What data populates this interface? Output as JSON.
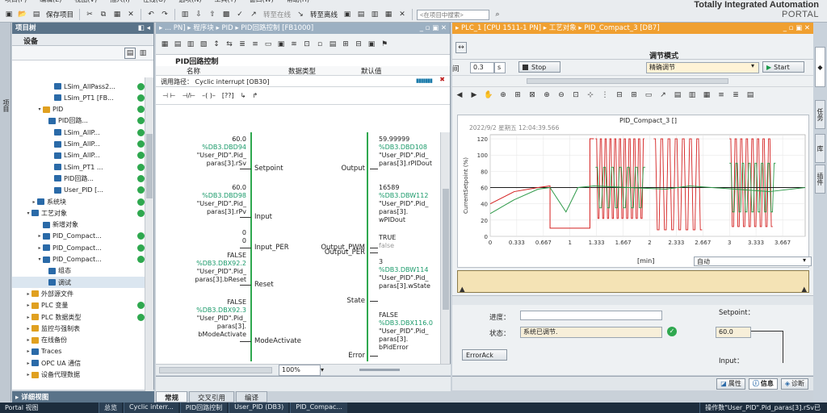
{
  "menu": [
    "项目(P)",
    "编辑(E)",
    "视图(V)",
    "插入(I)",
    "在线(O)",
    "选项(N)",
    "工具(T)",
    "窗口(W)",
    "帮助(H)"
  ],
  "toolbar": {
    "save_project": "保存项目",
    "go_online": "转至在线",
    "go_offline": "转至离线",
    "search_placeholder": "<在项目中搜索>"
  },
  "brand": {
    "line1": "Totally Integrated Automation",
    "line2": "PORTAL"
  },
  "left_strip": {
    "label": "项目"
  },
  "project_tree": {
    "title": "项目树",
    "device_header": "设备",
    "items": [
      {
        "label": "LSim_AllPass2...",
        "dot": true
      },
      {
        "label": "LSim_PT1 [FB...",
        "dot": true
      },
      {
        "label": "PID",
        "dot": true
      },
      {
        "label": "PID回路...",
        "dot": true
      },
      {
        "label": "LSim_AllP...",
        "dot": true
      },
      {
        "label": "LSim_AllP...",
        "dot": true
      },
      {
        "label": "LSim_AllP...",
        "dot": true
      },
      {
        "label": "LSim_PT1 ...",
        "dot": true
      },
      {
        "label": "PID回路...",
        "dot": true
      },
      {
        "label": "User_PID [...",
        "dot": true
      },
      {
        "label": "系统块",
        "dot": true
      },
      {
        "label": "工艺对象",
        "dot": true
      },
      {
        "label": "新增对象",
        "dot": false
      },
      {
        "label": "PID_Compact...",
        "dot": true
      },
      {
        "label": "PID_Compact...",
        "dot": true
      },
      {
        "label": "PID_Compact...",
        "dot": true
      },
      {
        "label": "组态",
        "dot": false
      },
      {
        "label": "调试",
        "dot": false
      },
      {
        "label": "外部源文件",
        "dot": false
      },
      {
        "label": "PLC 变量",
        "dot": true
      },
      {
        "label": "PLC 数据类型",
        "dot": true
      },
      {
        "label": "监控与强制表",
        "dot": false
      },
      {
        "label": "在线备份",
        "dot": false
      },
      {
        "label": "Traces",
        "dot": false
      },
      {
        "label": "OPC UA 通信",
        "dot": false
      },
      {
        "label": "设备代理数据",
        "dot": false
      }
    ],
    "detail_view": "详细视图"
  },
  "editor": {
    "breadcrumb": [
      "... PN]",
      "程序块",
      "PID",
      "PID回路控制 [FB1000]"
    ],
    "block_title": "PID回路控制",
    "col_name": "名称",
    "col_type": "数据类型",
    "col_default": "默认值",
    "call_path_label": "调用路径：",
    "call_path_value": "Cyclic interrupt [OB30]",
    "zoom": "100%",
    "inputs": [
      {
        "val": "60.0",
        "addr": "%DB3.DBD94",
        "name1": "\"User_PID\".Pid_",
        "name2": "paras[3].rSv",
        "pin": "Setpoint"
      },
      {
        "val": "60.0",
        "addr": "%DB3.DBD98",
        "name1": "\"User_PID\".Pid_",
        "name2": "paras[3].rPv",
        "pin": "Input"
      },
      {
        "val": "0",
        "val2": "0",
        "pin": "Input_PER"
      },
      {
        "val": "FALSE",
        "addr": "%DB3.DBX92.2",
        "name1": "\"User_PID\".Pid_",
        "name2": "paras[3].bReset",
        "pin": "Reset"
      },
      {
        "val": "FALSE",
        "addr": "%DB3.DBX92.3",
        "name1": "\"User_PID\".Pid_",
        "name2": "paras[3].",
        "name3": "bModeActivate",
        "pin": "ModeActivate"
      }
    ],
    "outputs": [
      {
        "val": "59.99999",
        "addr": "%DB3.DBD108",
        "name1": "\"User_PID\".Pid_",
        "name2": "paras[3].rPIDout",
        "pin": "Output"
      },
      {
        "val": "16589",
        "addr": "%DB3.DBW112",
        "name1": "\"User_PID\".Pid_",
        "name2": "paras[3].",
        "name3": "wPIDout",
        "pin": "Output_PER"
      },
      {
        "val": "TRUE",
        "val2": "false",
        "pin": "Output_PWM"
      },
      {
        "val": "3",
        "addr": "%DB3.DBW114",
        "name1": "\"User_PID\".Pid_",
        "name2": "paras[3].wState",
        "pin": "State"
      },
      {
        "val": "FALSE",
        "addr": "%DB3.DBX116.0",
        "name1": "\"User_PID\".Pid_",
        "name2": "paras[3].",
        "name3": "bPidError",
        "pin": "Error"
      }
    ]
  },
  "right": {
    "breadcrumb": [
      "PLC_1 [CPU 1511-1 PN]",
      "工艺对象",
      "PID_Compact_3 [DB7]"
    ],
    "tune_mode_label": "调节模式",
    "tune_mode_value": "精确调节",
    "start": "Start",
    "stop": "Stop",
    "interval_label": "间",
    "interval_value": "0.3",
    "interval_unit": "s",
    "chart_title": "PID_Compact_3 []",
    "timestamp": "2022/9/2 星期五 12:04:39.566",
    "xunit": "[min]",
    "auto": "自动",
    "progress_label": "进度：",
    "status_label": "状态：",
    "status_value": "系统已调节.",
    "error_ack": "ErrorAck",
    "setpoint_label": "Setpoint：",
    "setpoint_value": "60.0",
    "input_label": "Input："
  },
  "chart_data": {
    "type": "line",
    "title": "PID_Compact_3 []",
    "ylabel": "CurrentSetpoint (%)",
    "xlabel": "[min]",
    "x_ticks": [
      "0",
      "0.333",
      "0.667",
      "1",
      "1.333",
      "1.667",
      "2",
      "2.333",
      "2.667",
      "3",
      "3.333",
      "3.667"
    ],
    "y_ticks": [
      0,
      20,
      40,
      60,
      80,
      100,
      120
    ],
    "xlim": [
      0,
      3.95
    ],
    "ylim": [
      0,
      125
    ],
    "series": [
      {
        "color": "#1a1a1a",
        "x": [
          0,
          3.95
        ],
        "y": [
          60,
          60
        ]
      },
      {
        "color": "#d42020",
        "x": [
          0,
          0.3,
          0.6,
          0.75,
          0.75,
          1.25,
          1.25,
          1.3
        ],
        "y": [
          40,
          55,
          60,
          62,
          10,
          10,
          120,
          120
        ]
      },
      {
        "color": "#2f9a4a",
        "x": [
          0,
          0.3,
          0.6,
          0.75,
          0.95,
          1.1,
          1.3,
          2.2,
          2.5,
          3.5,
          3.95
        ],
        "y": [
          28,
          45,
          58,
          60,
          30,
          60,
          62,
          58,
          62,
          55,
          60
        ]
      }
    ]
  },
  "side_tabs": [
    "任务",
    "库",
    "插件"
  ],
  "inspector_tabs": {
    "props": "属性",
    "info": "信息",
    "diag": "诊断"
  },
  "bottom_tabs": [
    "常规",
    "交叉引用",
    "编译"
  ],
  "taskbar": [
    "Portal 视图",
    "总览",
    "Cyclic interr...",
    "PID回路控制",
    "User_PID (DB3)",
    "PID_Compac...",
    "操作数\"User_PID\".Pid_paras[3].rSv已"
  ]
}
